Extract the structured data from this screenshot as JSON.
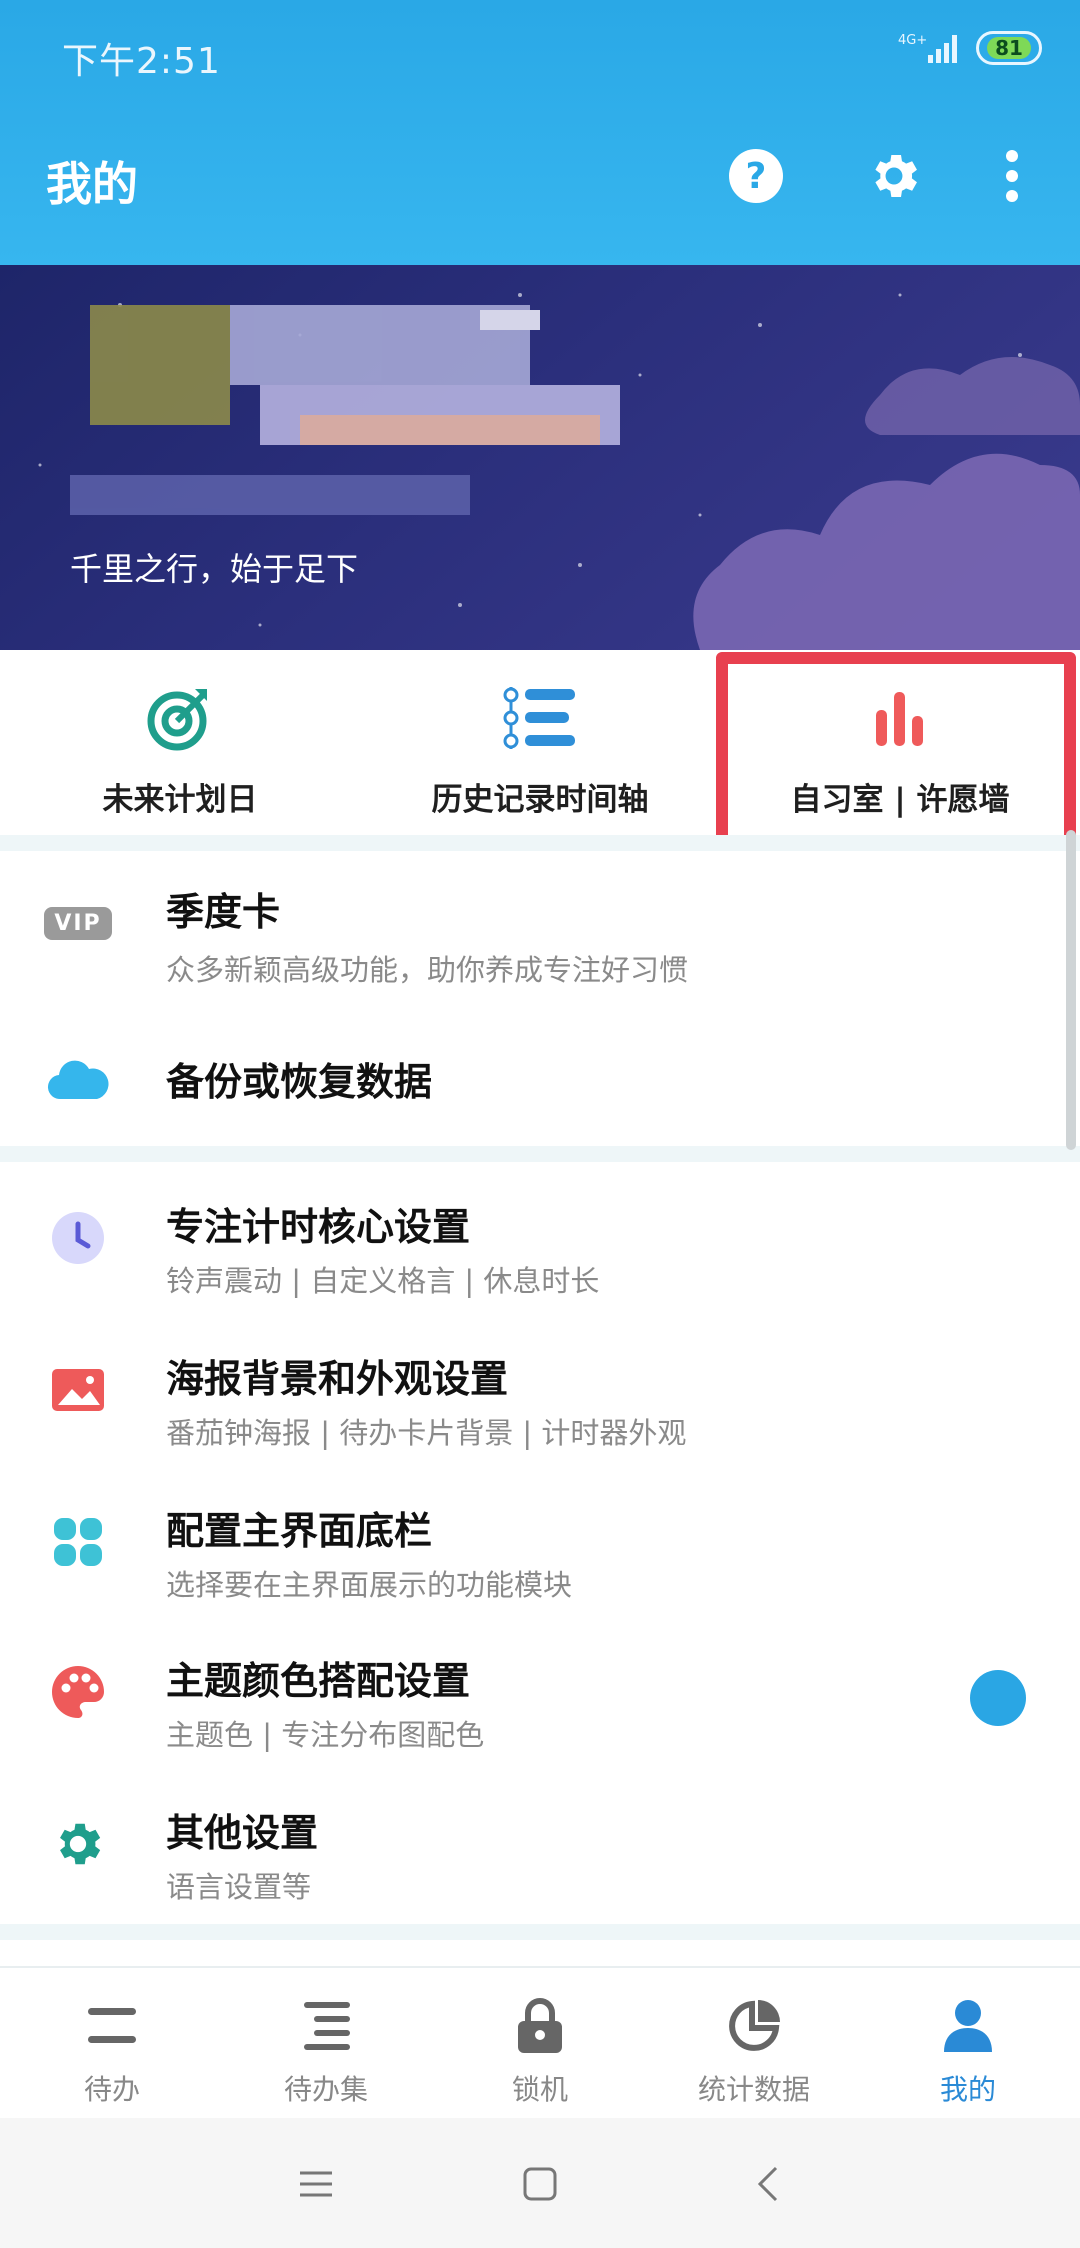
{
  "status_bar": {
    "time": "下午2:51",
    "network": "4G+",
    "battery": "81"
  },
  "header": {
    "title": "我的"
  },
  "banner": {
    "caption": "千里之行，始于足下"
  },
  "shortcuts": [
    {
      "label": "未来计划日",
      "icon": "target-icon",
      "color": "#1f9e8c"
    },
    {
      "label": "历史记录时间轴",
      "icon": "timeline-icon",
      "color": "#2f8fd8"
    },
    {
      "label": "自习室 | 许愿墙",
      "icon": "bar-chart-icon",
      "color": "#ef5a5a"
    }
  ],
  "sections": {
    "vip": {
      "badge": "VIP",
      "title": "季度卡",
      "subtitle": "众多新颖高级功能，助你养成专注好习惯"
    },
    "backup": {
      "title": "备份或恢复数据"
    },
    "focus": {
      "title": "专注计时核心设置",
      "subtitle": "铃声震动 | 自定义格言 | 休息时长"
    },
    "poster": {
      "title": "海报背景和外观设置",
      "subtitle": "番茄钟海报 | 待办卡片背景 | 计时器外观"
    },
    "nav_bar": {
      "title": "配置主界面底栏",
      "subtitle": "选择要在主界面展示的功能模块"
    },
    "theme": {
      "title": "主题颜色搭配设置",
      "subtitle": "主题色 | 专注分布图配色"
    },
    "other": {
      "title": "其他设置",
      "subtitle": "语言设置等"
    }
  },
  "bottom_nav": [
    {
      "label": "待办",
      "icon": "todo-icon",
      "active": false
    },
    {
      "label": "待办集",
      "icon": "todo-set-icon",
      "active": false
    },
    {
      "label": "锁机",
      "icon": "lock-icon",
      "active": false
    },
    {
      "label": "统计数据",
      "icon": "pie-chart-icon",
      "active": false
    },
    {
      "label": "我的",
      "icon": "person-icon",
      "active": true
    }
  ],
  "colors": {
    "header": "#2aa8e6",
    "highlight": "#e8404f",
    "active_tab": "#2a8ad6"
  }
}
